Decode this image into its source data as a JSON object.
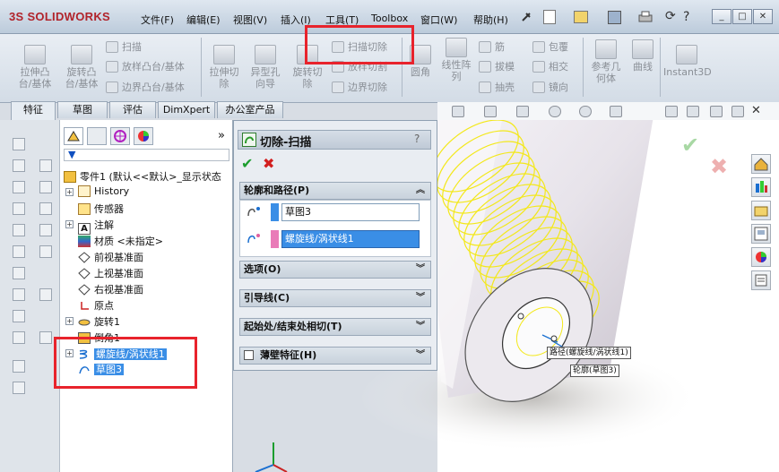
{
  "app": {
    "logo_ds": "3S",
    "logo_text": "SOLIDWORKS"
  },
  "menu": [
    "文件(F)",
    "编辑(E)",
    "视图(V)",
    "插入(I)",
    "工具(T)",
    "Toolbox",
    "窗口(W)",
    "帮助(H)"
  ],
  "ribbon": {
    "extrude_boss": "拉伸凸台/基体",
    "revolve_boss": "旋转凸台/基体",
    "sweep": "扫描",
    "loft_boss": "放样凸台/基体",
    "boundary_boss": "边界凸台/基体",
    "extrude_cut": "拉伸切除",
    "hole_wizard": "异型孔向导",
    "revolve_cut": "旋转切除",
    "sweep_cut": "扫描切除",
    "loft_cut": "放样切割",
    "boundary_cut": "边界切除",
    "fillet": "圆角",
    "linear_pattern": "线性阵列",
    "rib": "筋",
    "draft": "拔模",
    "shell": "抽壳",
    "wrap": "包覆",
    "intersect": "相交",
    "mirror": "镜向",
    "ref_geometry": "参考几何体",
    "curves": "曲线",
    "instant3d": "Instant3D"
  },
  "tabs": [
    "特征",
    "草图",
    "评估",
    "DimXpert",
    "办公室产品"
  ],
  "tree": {
    "root": "零件1 (默认<<默认>_显示状态",
    "items": [
      "History",
      "传感器",
      "注解",
      "材质 <未指定>",
      "前视基准面",
      "上视基准面",
      "右视基准面",
      "原点",
      "旋转1",
      "倒角1",
      "螺旋线/涡状线1",
      "草图3"
    ]
  },
  "pm": {
    "title": "切除-扫描",
    "help": "?",
    "section_profile": "轮廓和路径(P)",
    "profile_value": "草图3",
    "path_value": "螺旋线/涡状线1",
    "section_options": "选项(O)",
    "section_guides": "引导线(C)",
    "section_tangency": "起始处/结束处相切(T)",
    "section_thin": "薄壁特征(H)"
  },
  "callouts": {
    "path": "路径(螺旋线/涡状线1)",
    "profile": "轮廓(草图3)"
  },
  "colors": {
    "highlight": "#3a8ee6",
    "helix": "#f3e81a",
    "red_box": "#e8232c"
  }
}
